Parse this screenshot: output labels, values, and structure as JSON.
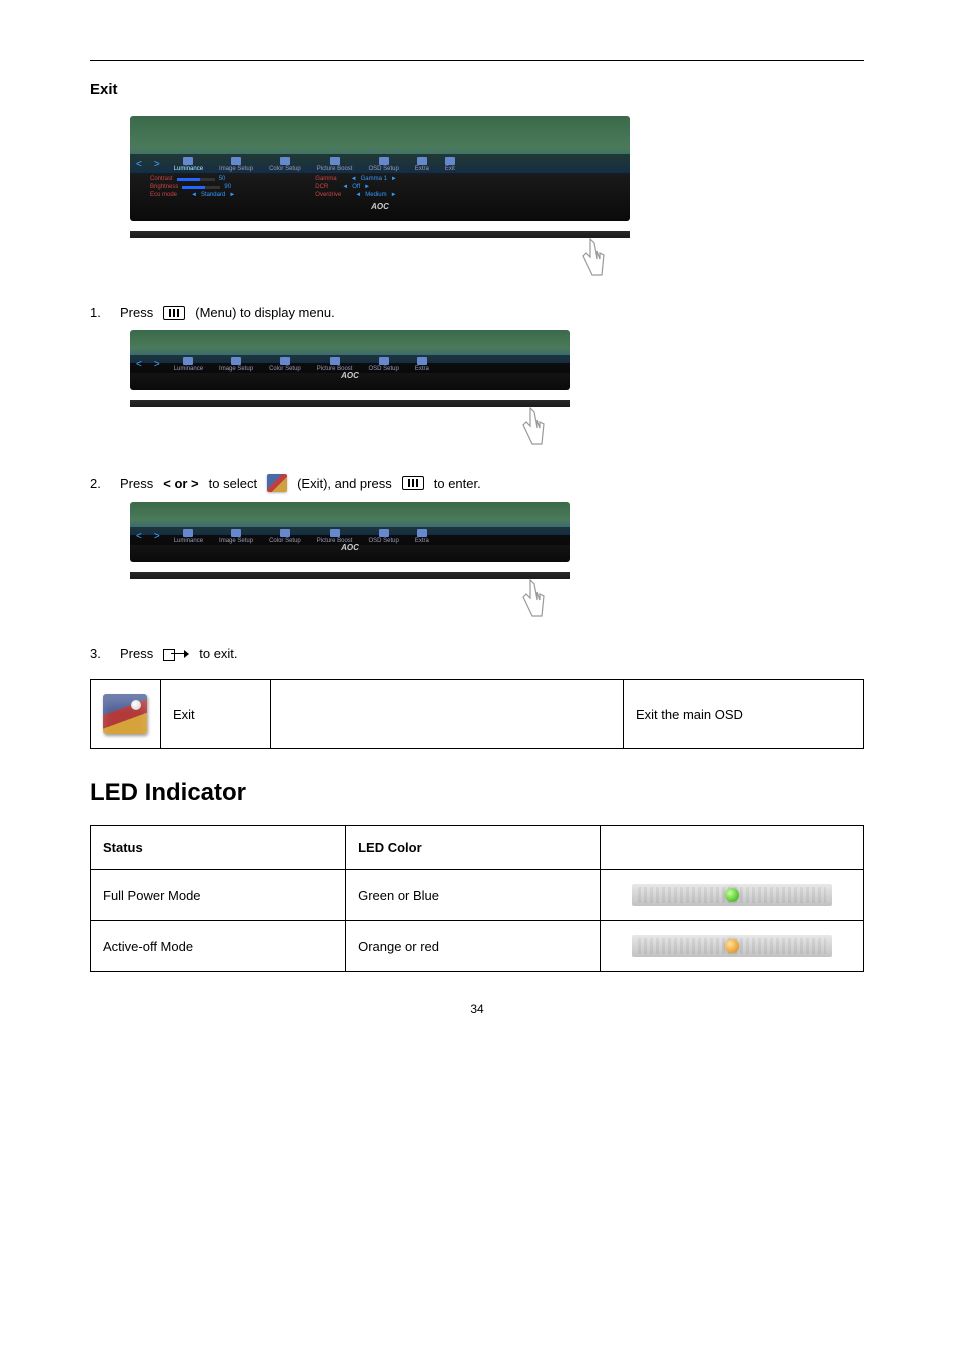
{
  "page_number": "34",
  "exit": {
    "heading": "Exit",
    "screenshot1": {
      "tabs": [
        "Luminance",
        "Image Setup",
        "Color Setup",
        "Picture Boost",
        "OSD Setup",
        "Extra",
        "Exit"
      ],
      "nav_prev": "<",
      "nav_next": ">",
      "rows_left": [
        {
          "label": "Contrast",
          "value": "50"
        },
        {
          "label": "Brightness",
          "value": "90"
        },
        {
          "label": "Eco mode",
          "value": "Standard"
        }
      ],
      "rows_right": [
        {
          "label": "Gamma",
          "value": "Gamma 1"
        },
        {
          "label": "DCR",
          "value": "Off"
        },
        {
          "label": "Overdrive",
          "value": "Medium"
        }
      ],
      "brand": "AOC"
    },
    "steps": {
      "s1_num": "1.",
      "s1_a": "Press",
      "s1_b": "(Menu) to display menu.",
      "s2_num": "2.",
      "s2_a": "Press",
      "s2_keys": "< or >",
      "s2_b": "to select",
      "s2_c": "(Exit), and press",
      "s2_d": "to enter.",
      "s3_num": "3.",
      "s3_a": "Press",
      "s3_b": "to exit."
    },
    "small_tabs": [
      "Luminance",
      "Image Setup",
      "Color Setup",
      "Picture Boost",
      "OSD Setup",
      "Extra"
    ],
    "small_brand": "AOC",
    "table": {
      "label": "Exit",
      "blank": "",
      "desc": "Exit the main OSD"
    }
  },
  "led": {
    "heading": "LED Indicator",
    "headers": {
      "status": "Status",
      "color": "LED Color",
      "img": ""
    },
    "rows": [
      {
        "status": "Full Power Mode",
        "color": "Green or Blue"
      },
      {
        "status": "Active-off Mode",
        "color": "Orange or red"
      }
    ]
  }
}
